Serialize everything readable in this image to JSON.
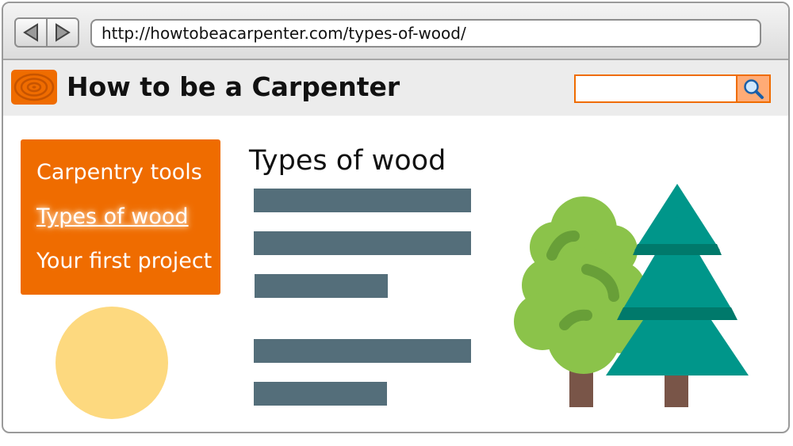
{
  "browser": {
    "back_icon": "arrow-left-icon",
    "forward_icon": "arrow-right-icon",
    "url": "http://howtobeacarpenter.com/types-of-wood/"
  },
  "site": {
    "logo_icon": "wood-rings-icon",
    "title": "How to be a Carpenter",
    "search_placeholder": "",
    "search_icon": "magnifier-icon"
  },
  "nav": {
    "items": [
      {
        "label": "Carpentry tools",
        "active": false
      },
      {
        "label": "Types of wood",
        "active": true
      },
      {
        "label": "Your first project",
        "active": false
      }
    ]
  },
  "content": {
    "heading": "Types of wood",
    "text_placeholder_lines": 5
  },
  "illustration": {
    "icon": "trees-icon",
    "colors": {
      "deciduous": "#8bc34a",
      "conifer": "#00968a",
      "trunk": "#795548"
    }
  },
  "colors": {
    "accent": "#ef6c00",
    "placeholder_text": "#546e7a",
    "circle": "#fdd97f"
  }
}
